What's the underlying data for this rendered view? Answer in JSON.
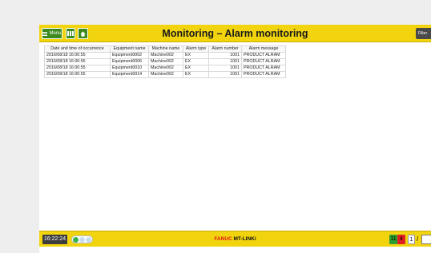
{
  "header": {
    "menu_label": "Menu",
    "title": "Monitoring – Alarm monitoring",
    "filter_label": "Filter"
  },
  "table": {
    "columns": [
      "Date and time of occurrence",
      "Equipment name",
      "Machine name",
      "Alarm type",
      "Alarm number",
      "Alarm message"
    ],
    "rows": [
      [
        "2016/08/18 16:00:55",
        "Equipment0002",
        "Machine002",
        "EX",
        "1001",
        "PRODUCT ALRAM"
      ],
      [
        "2016/08/18 16:00:55",
        "Equipment0006",
        "Machine002",
        "EX",
        "1001",
        "PRODUCT ALRAM"
      ],
      [
        "2016/08/18 16:00:55",
        "Equipment0010",
        "Machine002",
        "EX",
        "1001",
        "PRODUCT ALRAM"
      ],
      [
        "2016/08/18 16:00:55",
        "Equipment0014",
        "Machine002",
        "EX",
        "1001",
        "PRODUCT ALRAM"
      ]
    ]
  },
  "footer": {
    "clock": "16:22:24",
    "brand_fanuc": "FANUC",
    "brand_product": "MT-LINKi",
    "count_green": "11",
    "count_red": "4",
    "count_white": "1",
    "slash": "/"
  },
  "colors": {
    "bar_yellow": "#f2d40e",
    "button_green": "#3c8a1e",
    "brand_red": "#e0161b"
  }
}
